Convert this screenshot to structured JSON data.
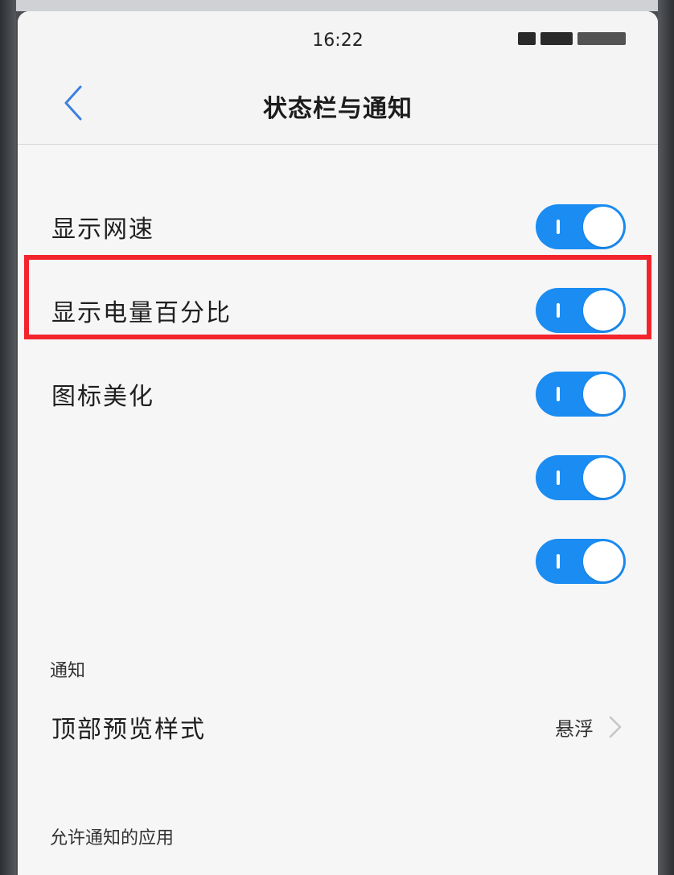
{
  "status_bar": {
    "time": "16:22"
  },
  "header": {
    "title": "状态栏与通知"
  },
  "settings": [
    {
      "label": "显示网速",
      "enabled": true
    },
    {
      "label": "显示电量百分比",
      "enabled": true
    },
    {
      "label": "图标美化",
      "enabled": true
    },
    {
      "label": "",
      "enabled": true
    },
    {
      "label": "",
      "enabled": true
    }
  ],
  "notification_section": {
    "header": "通知",
    "top_preview": {
      "label": "顶部预览样式",
      "value": "悬浮"
    }
  },
  "allowed_apps_section": {
    "header": "允许通知的应用"
  },
  "colors": {
    "toggle_on": "#1a8cf2",
    "highlight": "#f4242c",
    "back_arrow": "#3d7fe0"
  }
}
